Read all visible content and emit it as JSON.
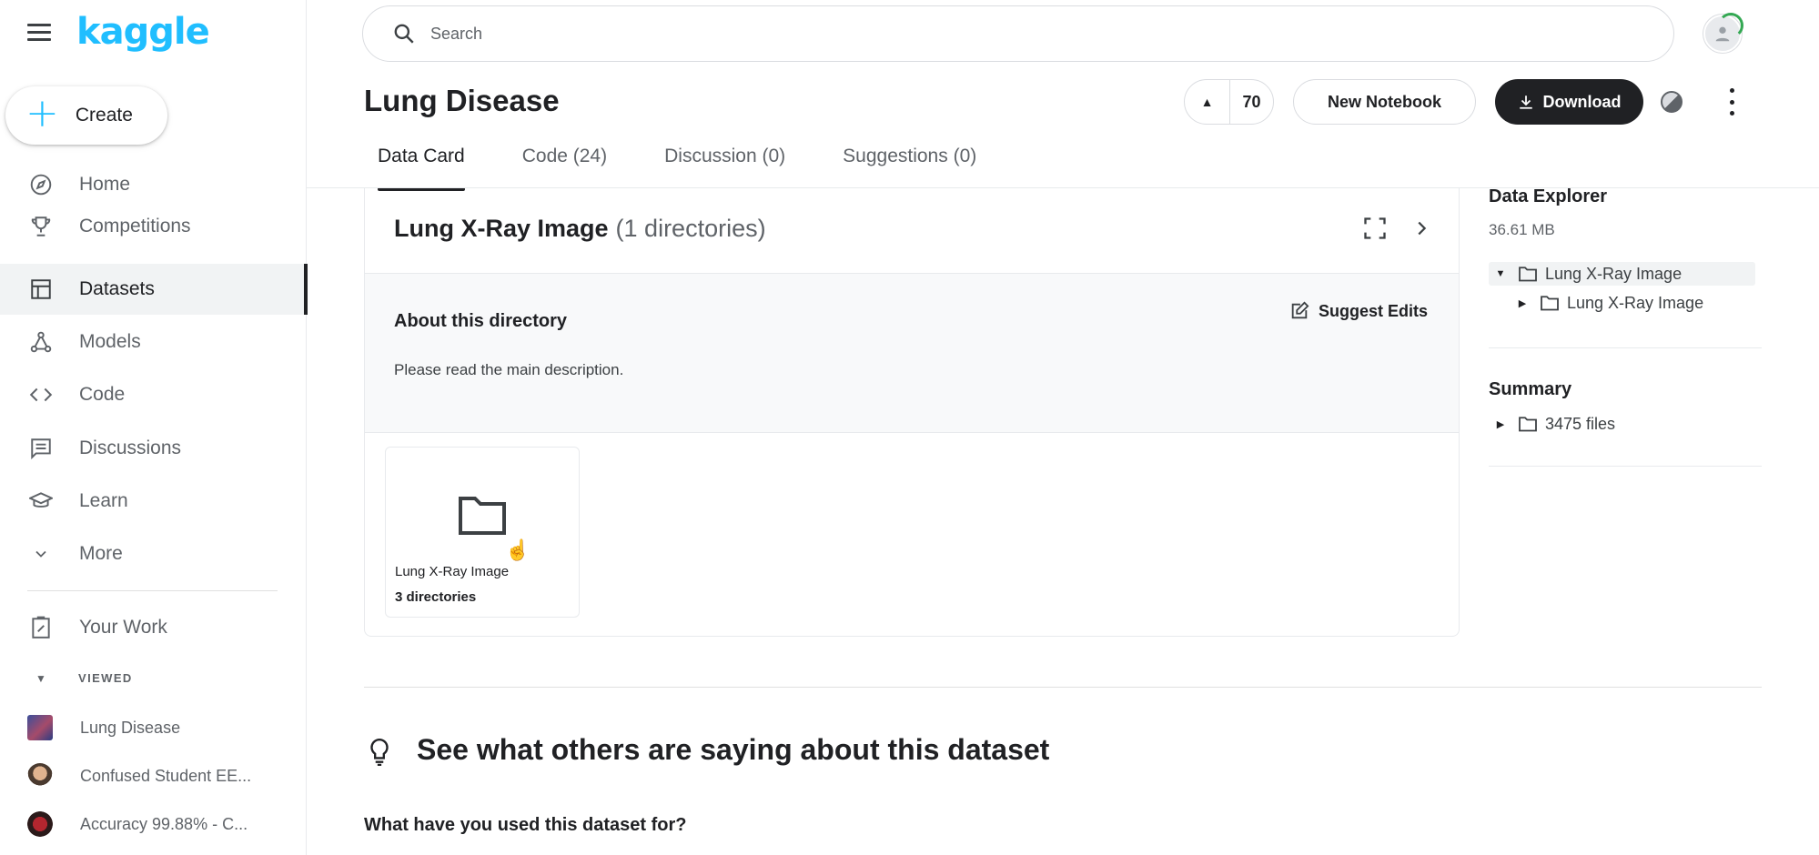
{
  "sidebar": {
    "logo": "kaggle",
    "create_label": "Create",
    "nav": [
      {
        "label": "Home",
        "icon": "compass-icon"
      },
      {
        "label": "Competitions",
        "icon": "trophy-icon"
      },
      {
        "label": "Datasets",
        "icon": "table-icon",
        "active": true
      },
      {
        "label": "Models",
        "icon": "models-icon"
      },
      {
        "label": "Code",
        "icon": "code-icon"
      },
      {
        "label": "Discussions",
        "icon": "discussion-icon"
      },
      {
        "label": "Learn",
        "icon": "graduation-cap-icon"
      },
      {
        "label": "More",
        "icon": "chevron-down-icon"
      }
    ],
    "your_work": "Your Work",
    "viewed_label": "VIEWED",
    "viewed": [
      {
        "label": "Lung Disease"
      },
      {
        "label": "Confused Student EE..."
      },
      {
        "label": "Accuracy 99.88% - C..."
      }
    ]
  },
  "search": {
    "placeholder": "Search"
  },
  "header": {
    "title": "Lung Disease",
    "votes": "70",
    "new_notebook": "New Notebook",
    "download": "Download"
  },
  "tabs": [
    {
      "label": "Data Card",
      "active": true
    },
    {
      "label": "Code (24)"
    },
    {
      "label": "Discussion (0)"
    },
    {
      "label": "Suggestions (0)"
    }
  ],
  "directory": {
    "title": "Lung X-Ray Image",
    "subtitle": "(1 directories)",
    "about_title": "About this directory",
    "suggest_edits": "Suggest Edits",
    "about_text": "Please read the main description.",
    "tile_name": "Lung X-Ray Image",
    "tile_meta": "3 directories"
  },
  "explorer": {
    "title": "Data Explorer",
    "size": "36.61 MB",
    "tree": [
      {
        "label": "Lung X-Ray Image",
        "level": 0,
        "expanded": true,
        "selected": true
      },
      {
        "label": "Lung X-Ray Image",
        "level": 1,
        "expanded": false
      }
    ],
    "summary_title": "Summary",
    "summary_files": "3475 files"
  },
  "bottom": {
    "heading": "See what others are saying about this dataset",
    "question": "What have you used this dataset for?"
  },
  "colors": {
    "brand": "#20beff",
    "dark": "#202124",
    "muted": "#5f6368"
  }
}
